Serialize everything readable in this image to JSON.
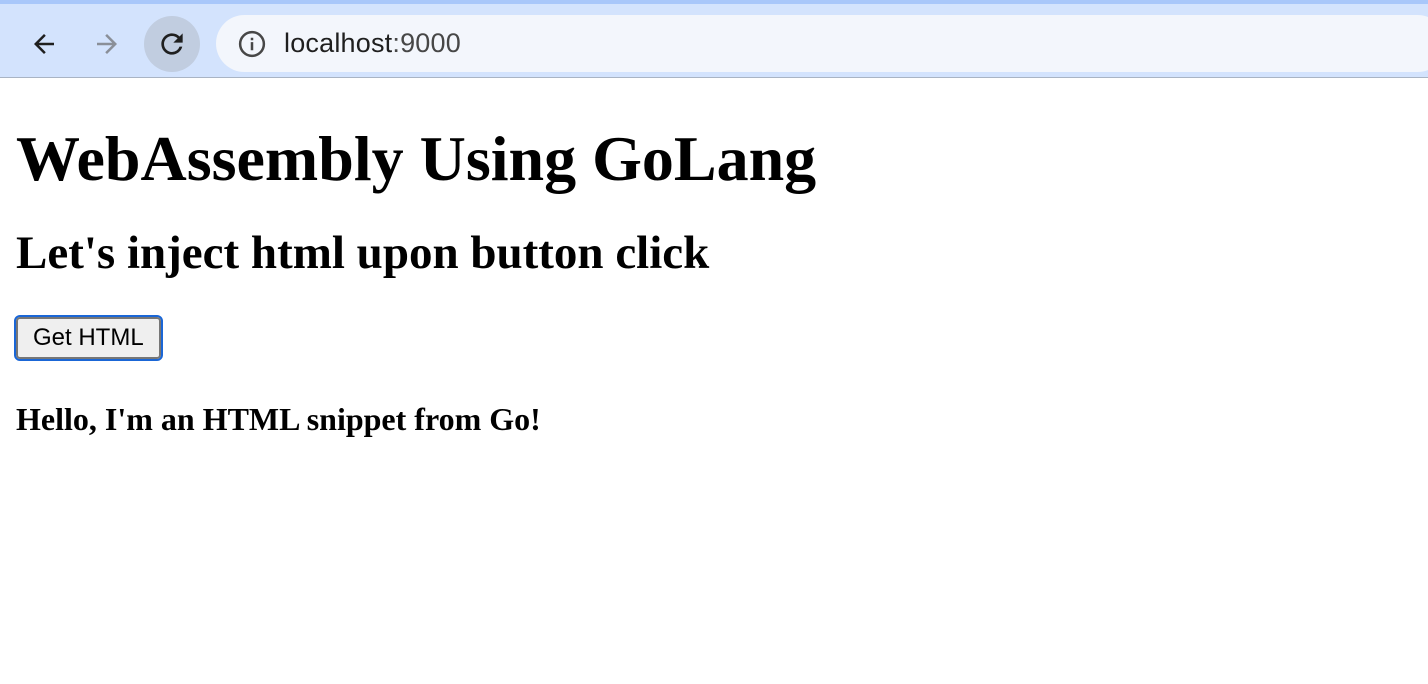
{
  "browser": {
    "url_host": "localhost",
    "url_port": ":9000",
    "back_icon": "arrow-left-icon",
    "forward_icon": "arrow-right-icon",
    "reload_icon": "reload-icon",
    "site_info_icon": "info-icon"
  },
  "page": {
    "title": "WebAssembly Using GoLang",
    "subtitle": "Let's inject html upon button click",
    "button_label": "Get HTML",
    "injected_text": "Hello, I'm an HTML snippet from Go!"
  },
  "colors": {
    "browser_bar": "#d3e3fd",
    "omnibox": "#f3f6fc",
    "button_focus_ring": "#1a66d6"
  }
}
